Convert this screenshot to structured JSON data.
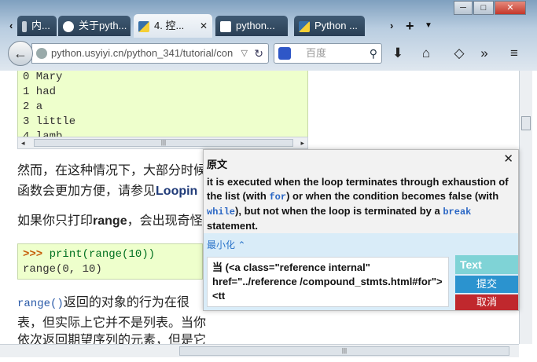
{
  "browser": {
    "tabs": [
      {
        "label": "内..."
      },
      {
        "label": "关于pyth..."
      },
      {
        "label": "4. 控..."
      },
      {
        "label": "python..."
      },
      {
        "label": "Python ..."
      }
    ],
    "url": "python.usyiyi.cn/python_341/tutorial/con",
    "search_placeholder": "百度",
    "win_min": "─",
    "win_max": "□",
    "win_close": "✕"
  },
  "page": {
    "code_lines": [
      "0 Mary",
      "1 had",
      "2 a",
      "3 little",
      "4 lamb"
    ],
    "para1_a": "然而，在这种情况下，大部分时候",
    "para1_b_pre": "函数会更加方便，请参见",
    "para1_b_link": "Loopin",
    "para2_pre": "如果你只打印",
    "para2_bold": "range",
    "para2_post": "，会出现奇怪",
    "code2_prompt": ">>>",
    "code2_cmd": "print(range(10))",
    "code2_out": "range(0, 10)",
    "para3_code": "range()",
    "para3_text": "返回的对象的行为在很",
    "para4": "表，但实际上它并不是列表。当你",
    "para5": "依次返回期望序列的元素，但是它"
  },
  "popup": {
    "header": "原文",
    "text_1": "it is executed when the loop terminates through exhaustion of the list (with ",
    "kw_for": "for",
    "text_2": ") or when the condition becomes false (with ",
    "kw_while": "while",
    "text_3": "), but not when the loop is terminated by a ",
    "kw_break": "break",
    "text_4": " statement.",
    "minimize": "最小化",
    "textarea": "当 (<a class=\"reference internal\" href=\"../reference /compound_stmts.html#for\"><tt",
    "tab_text": "Text",
    "submit": "提交",
    "cancel": "取消"
  }
}
